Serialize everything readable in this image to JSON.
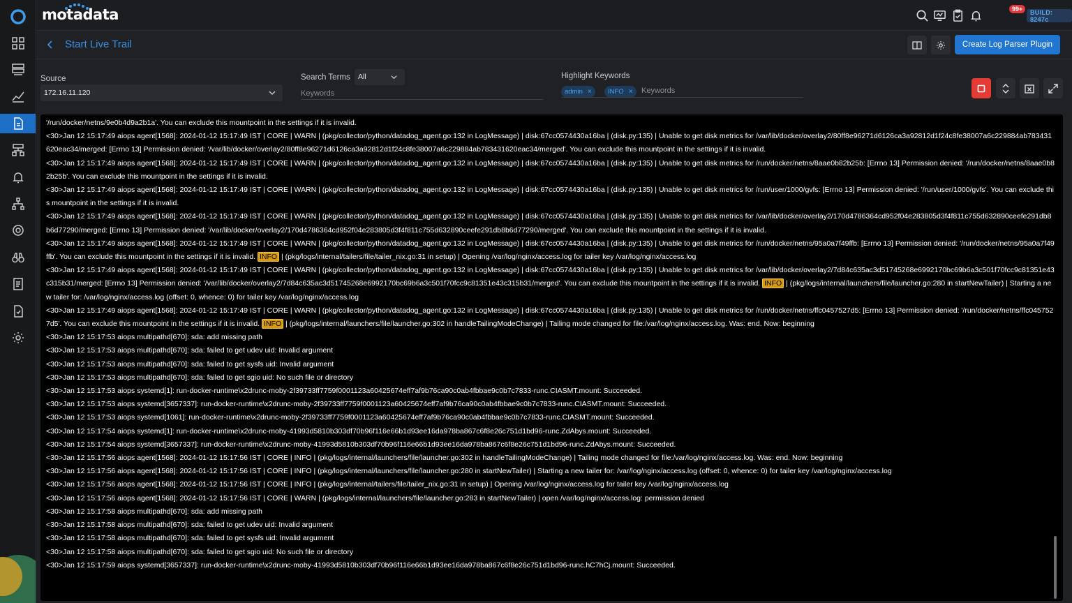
{
  "app": {
    "brand": "motadata"
  },
  "topbar": {
    "notification_badge": "99+",
    "build": "BUILD: 8247c",
    "icons": [
      "search-icon",
      "monitor-icon",
      "clipboard-icon",
      "bell-icon",
      "avatar"
    ]
  },
  "header": {
    "title": "Start Live Trail",
    "primary_button": "Create Log Parser Plugin"
  },
  "filters": {
    "source_label": "Source",
    "source_value": "172.16.11.120",
    "search_terms_label": "Search Terms",
    "search_terms_value": "All",
    "keywords_placeholder": "Keywords",
    "highlight_label": "Highlight Keywords",
    "highlight_chips": [
      "admin",
      "INFO"
    ],
    "highlight_placeholder": "Keywords"
  },
  "colors": {
    "accent": "#2176d2",
    "title": "#3d8fe0",
    "stop": "#e53b35",
    "highlight": "#d59a12"
  },
  "log_lines": [
    [
      {
        "t": "'/run/docker/netns/9e0b4d9a2b1a'. You can exclude this mountpoint in the settings if it is invalid."
      }
    ],
    [
      {
        "t": "<30>Jan 12 15:17:49 aiops agent[1568]: 2024-01-12 15:17:49 IST | CORE | WARN | (pkg/collector/python/datadog_agent.go:132 in LogMessage) | disk:67cc0574430a16ba | (disk.py:135) | Unable to get disk metrics for /var/lib/docker/overlay2/80ff8e96271d6126ca3a92812d1f24c8fe38007a6c229884ab783431620eac34/merged: [Errno 13] Permission denied: '/var/lib/docker/overlay2/80ff8e96271d6126ca3a92812d1f24c8fe38007a6c229884ab783431620eac34/merged'. You can exclude this mountpoint in the settings if it is invalid."
      }
    ],
    [
      {
        "t": "<30>Jan 12 15:17:49 aiops agent[1568]: 2024-01-12 15:17:49 IST | CORE | WARN | (pkg/collector/python/datadog_agent.go:132 in LogMessage) | disk:67cc0574430a16ba | (disk.py:135) | Unable to get disk metrics for /run/docker/netns/8aae0b82b25b: [Errno 13] Permission denied: '/run/docker/netns/8aae0b82b25b'. You can exclude this mountpoint in the settings if it is invalid."
      }
    ],
    [
      {
        "t": "<30>Jan 12 15:17:49 aiops agent[1568]: 2024-01-12 15:17:49 IST | CORE | WARN | (pkg/collector/python/datadog_agent.go:132 in LogMessage) | disk:67cc0574430a16ba | (disk.py:135) | Unable to get disk metrics for /run/user/1000/gvfs: [Errno 13] Permission denied: '/run/user/1000/gvfs'. You can exclude this mountpoint in the settings if it is invalid."
      }
    ],
    [
      {
        "t": "<30>Jan 12 15:17:49 aiops agent[1568]: 2024-01-12 15:17:49 IST | CORE | WARN | (pkg/collector/python/datadog_agent.go:132 in LogMessage) | disk:67cc0574430a16ba | (disk.py:135) | Unable to get disk metrics for /var/lib/docker/overlay2/170d4786364cd952f04e283805d3f4f811c755d632890ceefe291db8b6d77290/merged: [Errno 13] Permission denied: '/var/lib/docker/overlay2/170d4786364cd952f04e283805d3f4f811c755d632890ceefe291db8b6d77290/merged'. You can exclude this mountpoint in the settings if it is invalid."
      }
    ],
    [
      {
        "t": "<30>Jan 12 15:17:49 aiops agent[1568]: 2024-01-12 15:17:49 IST | CORE | WARN | (pkg/collector/python/datadog_agent.go:132 in LogMessage) | disk:67cc0574430a16ba | (disk.py:135) | Unable to get disk metrics for /run/docker/netns/95a0a7f49ffb: [Errno 13] Permission denied: '/run/docker/netns/95a0a7f49ffb'. You can exclude this mountpoint in the settings if it is invalid. "
      },
      {
        "t": "INFO",
        "hl": true
      },
      {
        "t": " | (pkg/logs/internal/tailers/file/tailer_nix.go:31 in setup) | Opening /var/log/nginx/access.log for tailer key /var/log/nginx/access.log"
      }
    ],
    [
      {
        "t": "<30>Jan 12 15:17:49 aiops agent[1568]: 2024-01-12 15:17:49 IST | CORE | WARN | (pkg/collector/python/datadog_agent.go:132 in LogMessage) | disk:67cc0574430a16ba | (disk.py:135) | Unable to get disk metrics for /var/lib/docker/overlay2/7d84c635ac3d51745268e6992170bc69b6a3c501f70fcc9c81351e43c315b31/merged: [Errno 13] Permission denied: '/var/lib/docker/overlay2/7d84c635ac3d51745268e6992170bc69b6a3c501f70fcc9c81351e43c315b31/merged'. You can exclude this mountpoint in the settings if it is invalid. "
      },
      {
        "t": "INFO",
        "hl": true
      },
      {
        "t": " | (pkg/logs/internal/launchers/file/launcher.go:280 in startNewTailer) | Starting a new tailer for: /var/log/nginx/access.log (offset: 0, whence: 0) for tailer key /var/log/nginx/access.log"
      }
    ],
    [
      {
        "t": "<30>Jan 12 15:17:49 aiops agent[1568]: 2024-01-12 15:17:49 IST | CORE | WARN | (pkg/collector/python/datadog_agent.go:132 in LogMessage) | disk:67cc0574430a16ba | (disk.py:135) | Unable to get disk metrics for /run/docker/netns/ffc0457527d5: [Errno 13] Permission denied: '/run/docker/netns/ffc0457527d5'. You can exclude this mountpoint in the settings if it is invalid. "
      },
      {
        "t": "INFO",
        "hl": true
      },
      {
        "t": " | (pkg/logs/internal/launchers/file/launcher.go:302 in handleTailingModeChange) | Tailing mode changed for file:/var/log/nginx/access.log. Was: end. Now: beginning"
      }
    ],
    [
      {
        "t": "<30>Jan 12 15:17:53 aiops multipathd[670]: sda: add missing path"
      }
    ],
    [
      {
        "t": "<30>Jan 12 15:17:53 aiops multipathd[670]: sda: failed to get udev uid: Invalid argument"
      }
    ],
    [
      {
        "t": "<30>Jan 12 15:17:53 aiops multipathd[670]: sda: failed to get sysfs uid: Invalid argument"
      }
    ],
    [
      {
        "t": "<30>Jan 12 15:17:53 aiops multipathd[670]: sda: failed to get sgio uid: No such file or directory"
      }
    ],
    [
      {
        "t": "<30>Jan 12 15:17:53 aiops systemd[1]: run-docker-runtime\\x2drunc-moby-2f39733ff7759f0001123a60425674eff7af9b76ca90c0ab4fbbae9c0b7c7833-runc.CIASMT.mount: Succeeded."
      }
    ],
    [
      {
        "t": "<30>Jan 12 15:17:53 aiops systemd[3657337]: run-docker-runtime\\x2drunc-moby-2f39733ff7759f0001123a60425674eff7af9b76ca90c0ab4fbbae9c0b7c7833-runc.CIASMT.mount: Succeeded."
      }
    ],
    [
      {
        "t": "<30>Jan 12 15:17:53 aiops systemd[1061]: run-docker-runtime\\x2drunc-moby-2f39733ff7759f0001123a60425674eff7af9b76ca90c0ab4fbbae9c0b7c7833-runc.CIASMT.mount: Succeeded."
      }
    ],
    [
      {
        "t": "<30>Jan 12 15:17:54 aiops systemd[1]: run-docker-runtime\\x2drunc-moby-41993d5810b303df70b96f116e66b1d93ee16da978ba867c6f8e26c751d1bd96-runc.ZdAbys.mount: Succeeded."
      }
    ],
    [
      {
        "t": "<30>Jan 12 15:17:54 aiops systemd[3657337]: run-docker-runtime\\x2drunc-moby-41993d5810b303df70b96f116e66b1d93ee16da978ba867c6f8e26c751d1bd96-runc.ZdAbys.mount: Succeeded."
      }
    ],
    [
      {
        "t": "<30>Jan 12 15:17:56 aiops agent[1568]: 2024-01-12 15:17:56 IST | CORE | INFO | (pkg/logs/internal/launchers/file/launcher.go:302 in handleTailingModeChange) | Tailing mode changed for file:/var/log/nginx/access.log. Was: end. Now: beginning"
      }
    ],
    [
      {
        "t": "<30>Jan 12 15:17:56 aiops agent[1568]: 2024-01-12 15:17:56 IST | CORE | INFO | (pkg/logs/internal/launchers/file/launcher.go:280 in startNewTailer) | Starting a new tailer for: /var/log/nginx/access.log (offset: 0, whence: 0) for tailer key /var/log/nginx/access.log"
      }
    ],
    [
      {
        "t": "<30>Jan 12 15:17:56 aiops agent[1568]: 2024-01-12 15:17:56 IST | CORE | INFO | (pkg/logs/internal/tailers/file/tailer_nix.go:31 in setup) | Opening /var/log/nginx/access.log for tailer key /var/log/nginx/access.log"
      }
    ],
    [
      {
        "t": "<30>Jan 12 15:17:56 aiops agent[1568]: 2024-01-12 15:17:56 IST | CORE | WARN | (pkg/logs/internal/launchers/file/launcher.go:283 in startNewTailer) | open /var/log/nginx/access.log: permission denied"
      }
    ],
    [
      {
        "t": "<30>Jan 12 15:17:58 aiops multipathd[670]: sda: add missing path"
      }
    ],
    [
      {
        "t": "<30>Jan 12 15:17:58 aiops multipathd[670]: sda: failed to get udev uid: Invalid argument"
      }
    ],
    [
      {
        "t": "<30>Jan 12 15:17:58 aiops multipathd[670]: sda: failed to get sysfs uid: Invalid argument"
      }
    ],
    [
      {
        "t": "<30>Jan 12 15:17:58 aiops multipathd[670]: sda: failed to get sgio uid: No such file or directory"
      }
    ],
    [
      {
        "t": "<30>Jan 12 15:17:59 aiops systemd[3657337]: run-docker-runtime\\x2drunc-moby-41993d5810b303df70b96f116e66b1d93ee16da978ba867c6f8e26c751d1bd96-runc.hC7hCj.mount: Succeeded."
      }
    ]
  ]
}
